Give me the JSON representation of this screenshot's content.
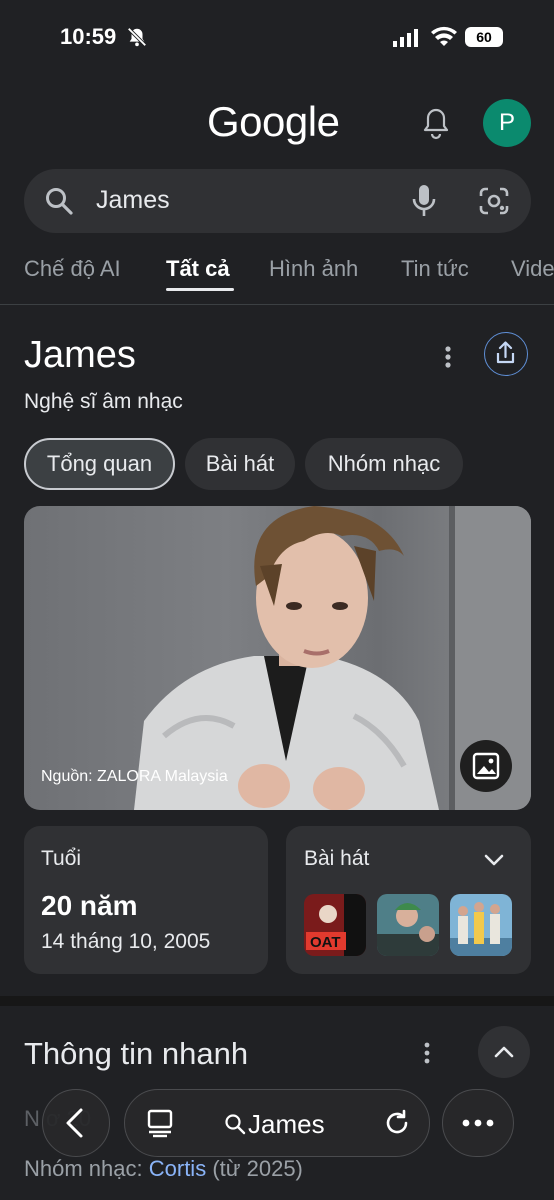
{
  "status_bar": {
    "time": "10:59",
    "battery": "60"
  },
  "header": {
    "logo": "Google",
    "avatar_initial": "P"
  },
  "search": {
    "query": "James"
  },
  "tabs": [
    {
      "label": "Chế độ AI"
    },
    {
      "label": "Tất cả",
      "active": true
    },
    {
      "label": "Hình ảnh"
    },
    {
      "label": "Tin tức"
    },
    {
      "label": "Vide"
    }
  ],
  "knowledge_panel": {
    "title": "James",
    "subtitle": "Nghệ sĩ âm nhạc",
    "chips": [
      {
        "label": "Tổng quan",
        "active": true
      },
      {
        "label": "Bài hát"
      },
      {
        "label": "Nhóm nhạc"
      }
    ],
    "image_source": "Nguồn: ZALORA Malaysia",
    "age_card": {
      "label": "Tuổi",
      "value": "20 năm",
      "date": "14 tháng 10, 2005"
    },
    "songs_card": {
      "label": "Bài hát"
    }
  },
  "quick_info": {
    "title": "Thông tin nhanh",
    "group_label": "Nhóm nhạc:",
    "group_value": "Cortis",
    "group_suffix": "(từ 2025)",
    "partial_row": "N          ơ                                      20"
  },
  "bottom_nav": {
    "query": "James"
  },
  "colors": {
    "background": "#202124",
    "surface": "#303134",
    "link": "#8ab4f8",
    "avatar": "#0b8a6e"
  }
}
